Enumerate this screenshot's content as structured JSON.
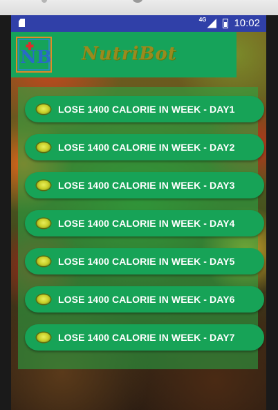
{
  "status_bar": {
    "network": "4G",
    "time": "10:02"
  },
  "app_bar": {
    "logo_text": "NB",
    "brand_name": "NutriBot",
    "color": "#16a35a"
  },
  "days": [
    {
      "label": "LOSE 1400 CALORIE IN WEEK - DAY1"
    },
    {
      "label": "LOSE 1400 CALORIE IN WEEK - DAY2"
    },
    {
      "label": "LOSE 1400 CALORIE IN WEEK - DAY3"
    },
    {
      "label": "LOSE 1400 CALORIE IN WEEK - DAY4"
    },
    {
      "label": "LOSE 1400 CALORIE IN WEEK - DAY5"
    },
    {
      "label": "LOSE 1400 CALORIE IN WEEK - DAY6"
    },
    {
      "label": "LOSE 1400 CALORIE IN WEEK - DAY7"
    }
  ],
  "colors": {
    "button_bg": "#17a357",
    "status_bar": "#3040a8",
    "brand_text": "#9a8a1e"
  },
  "icons": {
    "day_icon": "lemon-icon",
    "status_left": "sd-card-icon",
    "signal": "signal-icon",
    "battery": "battery-icon"
  }
}
